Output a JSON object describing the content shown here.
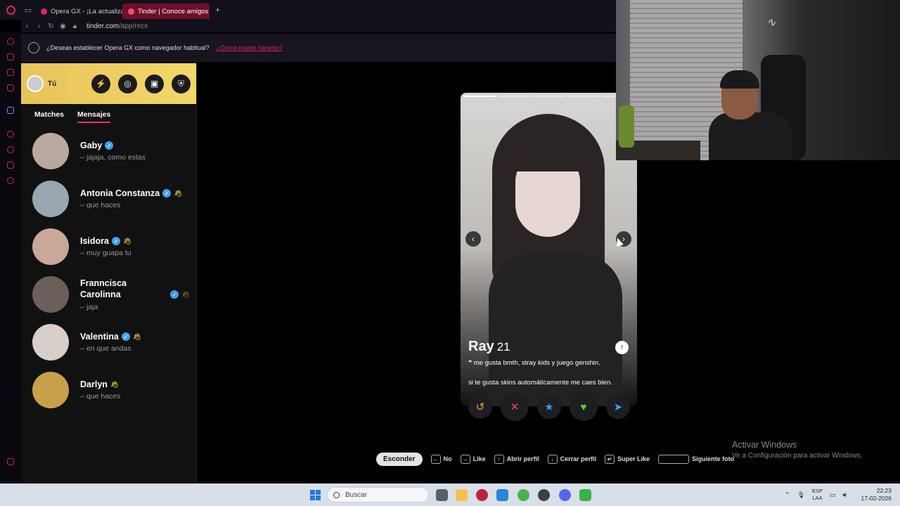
{
  "browser": {
    "tabs": [
      {
        "label": "Opera GX - ¡La actualizac",
        "favicon_color": "#e0245e",
        "active": false
      },
      {
        "label": "Tinder | Conoce amigos y",
        "favicon_color": "#fd4a6d",
        "active": true
      }
    ],
    "new_tab": "+",
    "url_host": "tinder.com",
    "url_path": "/app/recs"
  },
  "notice": {
    "text": "¿Deseas establecer Opera GX como navegador habitual?",
    "link": "¿Cómo puedo hacerlo?"
  },
  "sidebar": {
    "me_label": "Tú",
    "tabs": [
      "Matches",
      "Mensajes"
    ],
    "messages": [
      {
        "name": "Gaby",
        "preview": "jajaja, como estas",
        "verified": true,
        "wave": false,
        "avatar_color": "#b8a8a0"
      },
      {
        "name": "Antonia Constanza",
        "preview": "que haces",
        "verified": true,
        "wave": true,
        "avatar_color": "#9aa7b0"
      },
      {
        "name": "Isidora",
        "preview": "muy guapa tu",
        "verified": true,
        "wave": true,
        "avatar_color": "#c9a89a"
      },
      {
        "name": "Franncisca Carolinna",
        "preview": "jaja",
        "verified": true,
        "wave": true,
        "avatar_color": "#6b5f5a"
      },
      {
        "name": "Valentina",
        "preview": "en que andas",
        "verified": true,
        "wave": true,
        "avatar_color": "#d8cfc9"
      },
      {
        "name": "Darlyn",
        "preview": "que haces",
        "verified": false,
        "wave": true,
        "avatar_color": "#c9a04a"
      }
    ]
  },
  "card": {
    "name": "Ray",
    "age": "21",
    "bio_line1": "me gusta bmth, stray kids y juego genshin.",
    "bio_line2": "si te gusta skins automáticamente me caes bien."
  },
  "actions": {
    "rewind": "↺",
    "nope": "✕",
    "super": "★",
    "like": "♥",
    "boost": "➤",
    "colors": {
      "rewind": "#f5a623",
      "nope": "#fd3c6e",
      "super": "#2d9cff",
      "like": "#5bd135",
      "boost": "#3aa3f5"
    }
  },
  "hints": {
    "hide": "Esconder",
    "items": [
      "No",
      "Like",
      "Abrir perfil",
      "Cerrar perfil",
      "Super Like",
      "Siguiente foto"
    ]
  },
  "activate": {
    "line1": "Activar Windows",
    "line2": "Ve a Configuración para activar Windows."
  },
  "taskbar": {
    "search_placeholder": "Buscar",
    "lang_top": "ESP",
    "lang_bottom": "LAA",
    "time": "22:23",
    "date": "17-02-2026"
  }
}
